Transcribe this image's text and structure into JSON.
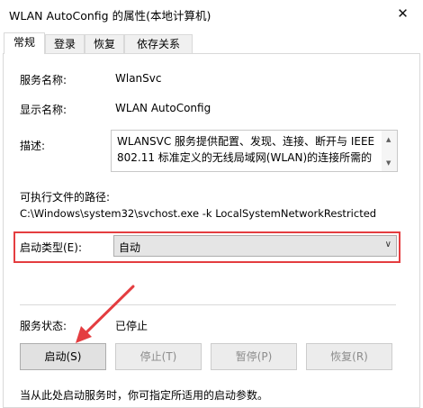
{
  "window": {
    "title": "WLAN AutoConfig 的属性(本地计算机)",
    "close_glyph": "✕"
  },
  "tabs": [
    {
      "label": "常规",
      "active": true
    },
    {
      "label": "登录"
    },
    {
      "label": "恢复"
    },
    {
      "label": "依存关系"
    }
  ],
  "general": {
    "service_name_label": "服务名称:",
    "service_name_value": "WlanSvc",
    "display_name_label": "显示名称:",
    "display_name_value": "WLAN AutoConfig",
    "description_label": "描述:",
    "description_value": "WLANSVC 服务提供配置、发现、连接、断开与 IEEE 802.11 标准定义的无线局域网(WLAN)的连接所需的",
    "exe_path_label": "可执行文件的路径:",
    "exe_path_value": "C:\\Windows\\system32\\svchost.exe -k LocalSystemNetworkRestricted",
    "startup_type_label": "启动类型(E):",
    "startup_type_value": "自动",
    "status_label": "服务状态:",
    "status_value": "已停止",
    "buttons": {
      "start": "启动(S)",
      "stop": "停止(T)",
      "pause": "暂停(P)",
      "resume": "恢复(R)"
    },
    "hint": "当从此处启动服务时，你可指定所适用的启动参数。"
  },
  "colors": {
    "highlight": "#e43d40",
    "arrow": "#e43d40"
  }
}
